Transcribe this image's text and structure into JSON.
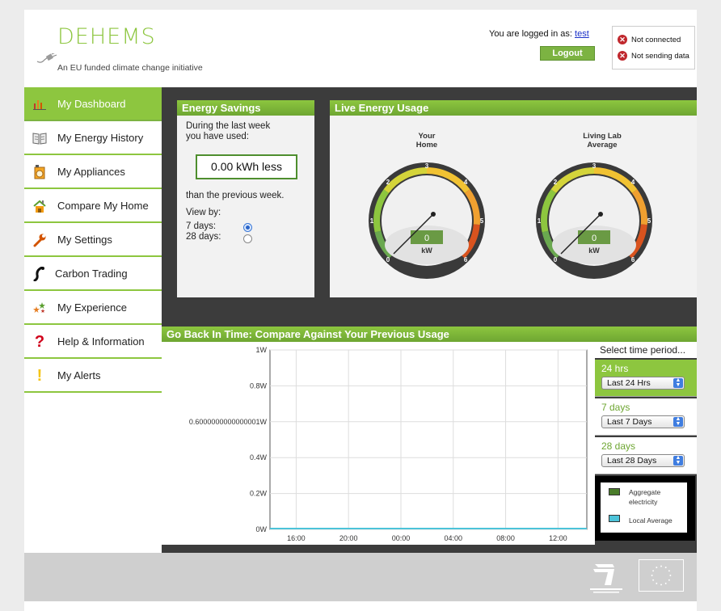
{
  "header": {
    "logo_text": "DEHEMS",
    "tagline": "An EU funded climate change initiative",
    "login_prefix": "You are logged in as: ",
    "username": "test",
    "logout_label": "Logout",
    "status": [
      {
        "label": "Not connected",
        "icon": "error-x-icon"
      },
      {
        "label": "Not sending data",
        "icon": "error-x-icon"
      }
    ]
  },
  "sidebar": {
    "items": [
      {
        "label": "My Dashboard",
        "icon": "bar-chart-icon",
        "active": true
      },
      {
        "label": "My Energy History",
        "icon": "book-icon"
      },
      {
        "label": "My Appliances",
        "icon": "appliance-icon"
      },
      {
        "label": "Compare My Home",
        "icon": "house-icon"
      },
      {
        "label": "My Settings",
        "icon": "wrench-icon"
      },
      {
        "label": "Carbon Trading",
        "icon": "phone-icon"
      },
      {
        "label": "My Experience",
        "icon": "stars-icon"
      },
      {
        "label": "Help & Information",
        "icon": "question-icon"
      },
      {
        "label": "My Alerts",
        "icon": "exclamation-icon"
      }
    ]
  },
  "energy_savings": {
    "title": "Energy Savings",
    "line1": "During the last week",
    "line2": "you have used:",
    "value": "0.00 kWh less",
    "comparison": "than the previous week.",
    "view_by": "View by:",
    "option_7": "7 days:",
    "option_28": "28 days:",
    "selected": "7 days"
  },
  "live_usage": {
    "title": "Live Energy Usage",
    "gauges": [
      {
        "title_line1": "Your",
        "title_line2": "Home",
        "value": "0",
        "unit": "kW",
        "ticks": [
          "0",
          "1",
          "2",
          "3",
          "4",
          "5",
          "6"
        ]
      },
      {
        "title_line1": "Living Lab",
        "title_line2": "Average",
        "value": "0",
        "unit": "kW",
        "ticks": [
          "0",
          "1",
          "2",
          "3",
          "4",
          "5",
          "6"
        ]
      }
    ]
  },
  "history": {
    "title": "Go Back In Time: Compare Against Your Previous Usage",
    "time_period": {
      "header": "Select time period...",
      "options": [
        {
          "label": "24 hrs",
          "select": "Last 24 Hrs",
          "active": true
        },
        {
          "label": "7 days",
          "select": "Last 7 Days"
        },
        {
          "label": "28 days",
          "select": "Last 28 Days"
        }
      ]
    },
    "legend": [
      {
        "label_line1": "Aggregate",
        "label_line2": "electricity",
        "color": "#4a7c2a"
      },
      {
        "label_line1": "Local Average",
        "label_line2": "",
        "color": "#4cc3d9"
      }
    ]
  },
  "chart_data": {
    "type": "line",
    "x_ticks": [
      "16:00",
      "20:00",
      "00:00",
      "04:00",
      "08:00",
      "12:00"
    ],
    "y_ticks": [
      "1W",
      "0.8W",
      "0.6000000000000001W",
      "0.4W",
      "0.2W",
      "0W"
    ],
    "ylim": [
      0,
      1
    ],
    "grid": true,
    "series": [
      {
        "name": "Aggregate electricity",
        "color": "#4a7c2a",
        "values": [
          0,
          0,
          0,
          0,
          0,
          0
        ]
      },
      {
        "name": "Local Average",
        "color": "#4cc3d9",
        "values": [
          0,
          0,
          0,
          0,
          0,
          0
        ]
      }
    ],
    "legend_position": "right"
  }
}
